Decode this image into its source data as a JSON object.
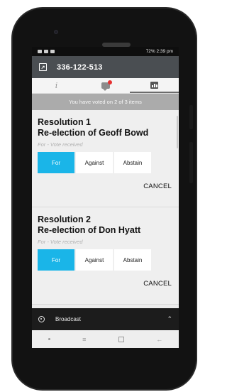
{
  "statusbar": {
    "right_text": "72% 2:39 pm"
  },
  "appbar": {
    "title": "336-122-513",
    "left_icon": "exit-icon"
  },
  "tabs": [
    {
      "name": "info",
      "icon": "info-icon"
    },
    {
      "name": "messages",
      "icon": "chat-icon"
    },
    {
      "name": "results",
      "icon": "chart-icon"
    }
  ],
  "banner": "You have voted on 2 of 3 items",
  "resolutions": [
    {
      "line1": "Resolution 1",
      "line2": "Re-election of Geoff Bowd",
      "status": "For - Vote received",
      "options": [
        "For",
        "Against",
        "Abstain"
      ],
      "selected": "For",
      "cancel": "CANCEL"
    },
    {
      "line1": "Resolution 2",
      "line2": "Re-election of Don Hyatt",
      "status": "For - Vote received",
      "options": [
        "For",
        "Against",
        "Abstain"
      ],
      "selected": "For",
      "cancel": "CANCEL"
    }
  ],
  "broadcast": {
    "label": "Broadcast"
  },
  "colors": {
    "selected": "#1ab5e8",
    "appbar": "#4a4e52",
    "badge": "#e63030"
  }
}
